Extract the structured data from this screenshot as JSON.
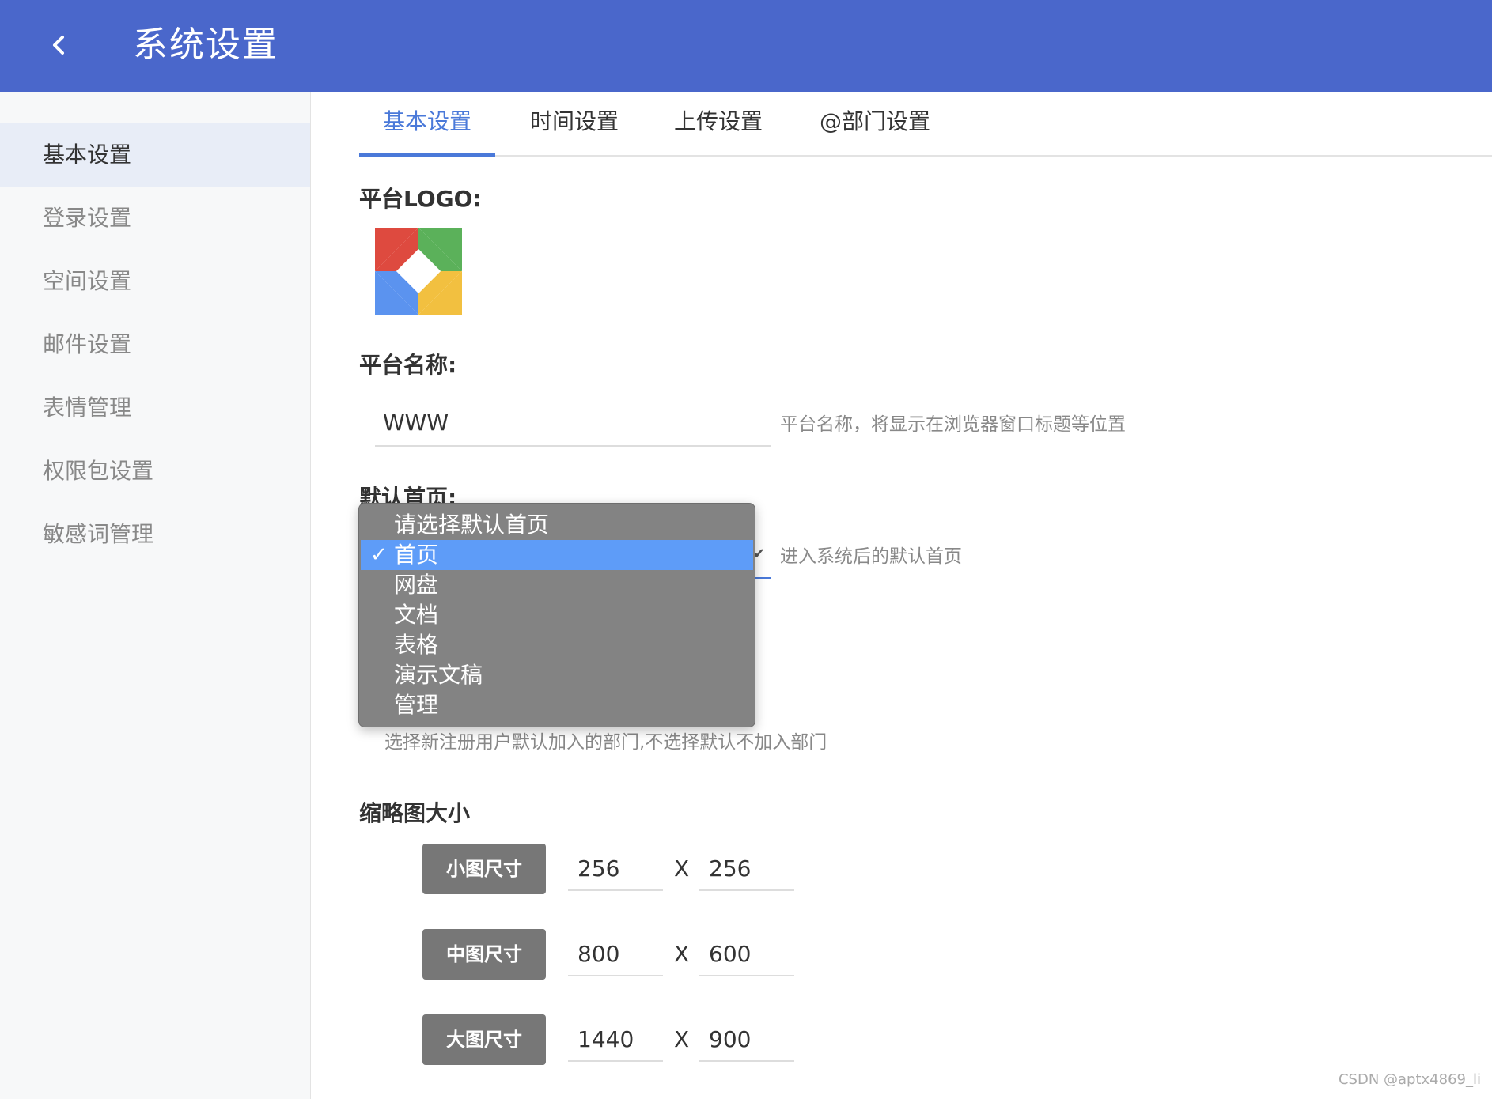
{
  "header": {
    "title": "系统设置"
  },
  "sidebar": {
    "items": [
      {
        "label": "基本设置",
        "active": true
      },
      {
        "label": "登录设置"
      },
      {
        "label": "空间设置"
      },
      {
        "label": "邮件设置"
      },
      {
        "label": "表情管理"
      },
      {
        "label": "权限包设置"
      },
      {
        "label": "敏感词管理"
      }
    ]
  },
  "tabs": [
    {
      "label": "基本设置",
      "active": true
    },
    {
      "label": "时间设置"
    },
    {
      "label": "上传设置"
    },
    {
      "label": "@部门设置"
    }
  ],
  "form": {
    "logo_label": "平台LOGO:",
    "name_label": "平台名称:",
    "name_value": "WWW",
    "name_hint": "平台名称，将显示在浏览器窗口标题等位置",
    "home_label": "默认首页:",
    "home_hint": "进入系统后的默认首页",
    "home_options": [
      "请选择默认首页",
      "首页",
      "网盘",
      "文档",
      "表格",
      "演示文稿",
      "管理"
    ],
    "home_selected": "首页",
    "dept_hint": "选择新注册用户默认加入的部门,不选择默认不加入部门",
    "thumb_label": "缩略图大小",
    "thumb_sizes": [
      {
        "label": "小图尺寸",
        "width": "256",
        "height": "256"
      },
      {
        "label": "中图尺寸",
        "width": "800",
        "height": "600"
      },
      {
        "label": "大图尺寸",
        "width": "1440",
        "height": "900"
      }
    ],
    "x_sep": "X"
  },
  "watermark": "CSDN @aptx4869_li",
  "colors": {
    "header_bg": "#4a67cb",
    "accent": "#4a79d9",
    "dropdown_bg": "#838383",
    "dropdown_selected": "#5e9cf8"
  },
  "icons": {
    "back": "chevron-left-icon",
    "check": "check-icon"
  }
}
